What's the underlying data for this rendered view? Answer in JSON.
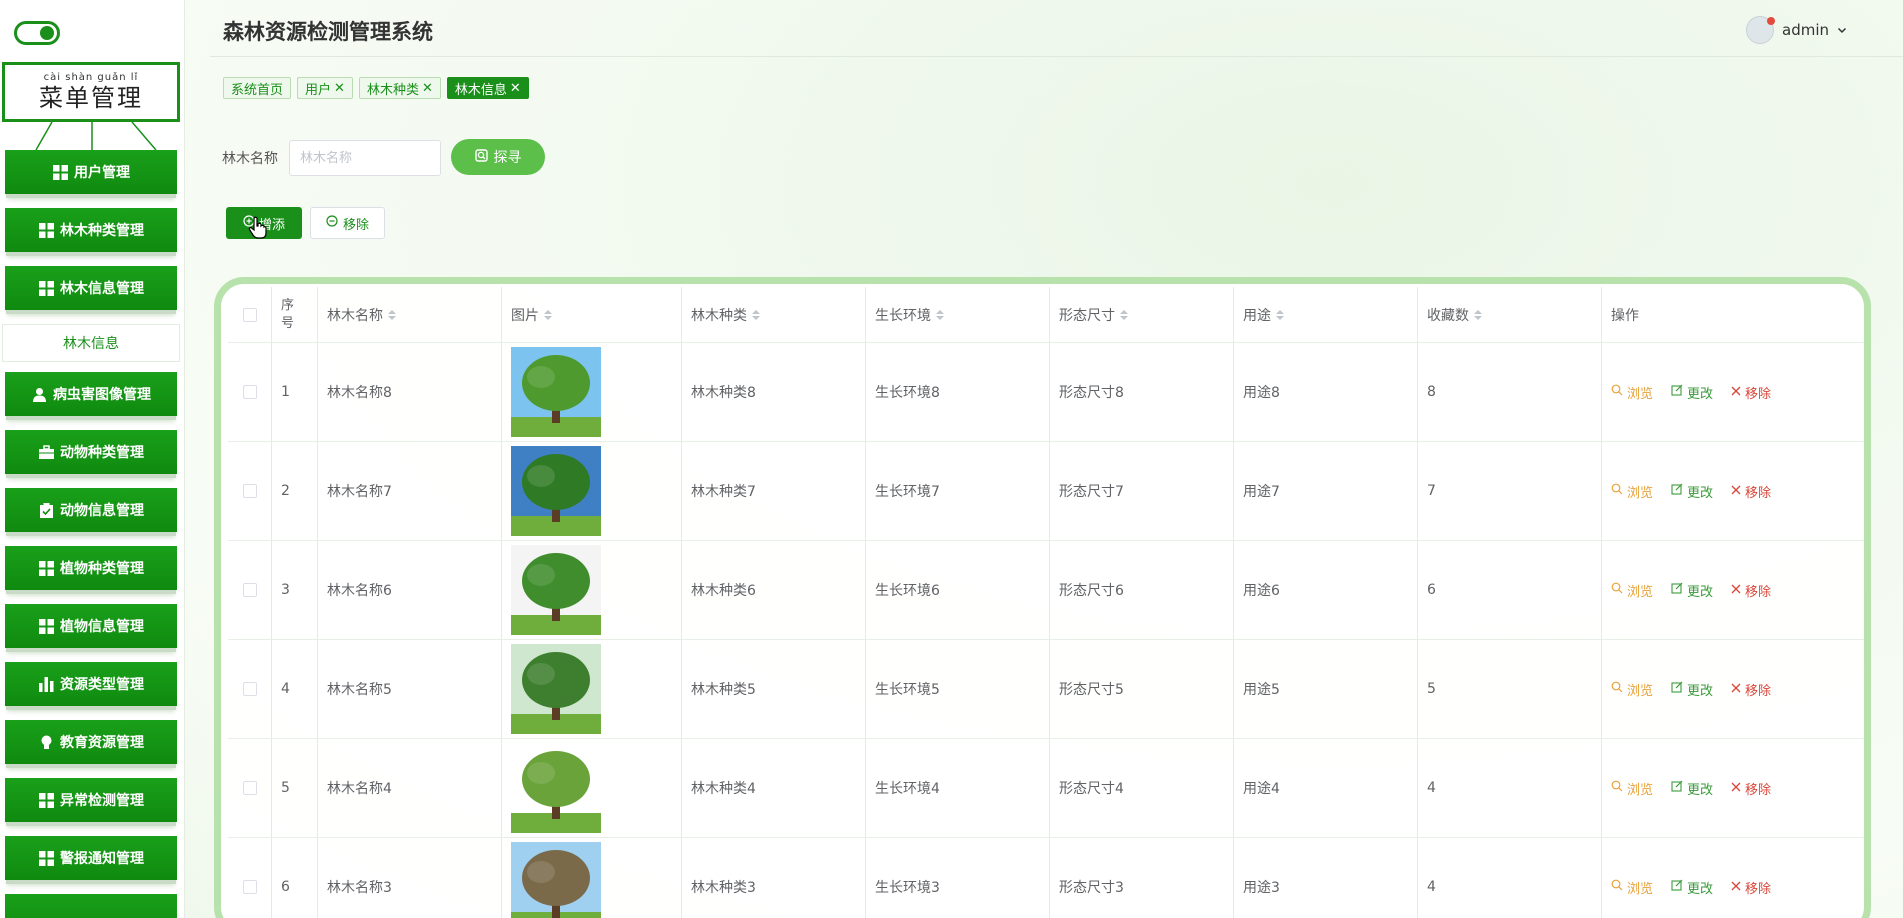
{
  "app": {
    "title": "森林资源检测管理系统"
  },
  "user": {
    "name": "admin"
  },
  "sidebar": {
    "title_pinyin": "cài shàn guǎn lǐ",
    "title": "菜单管理",
    "items": [
      {
        "label": "用户管理",
        "icon": "grid-icon"
      },
      {
        "label": "林木种类管理",
        "icon": "grid-icon"
      },
      {
        "label": "林木信息管理",
        "icon": "grid-icon"
      },
      {
        "label": "病虫害图像管理",
        "icon": "user-icon"
      },
      {
        "label": "动物种类管理",
        "icon": "briefcase-icon"
      },
      {
        "label": "动物信息管理",
        "icon": "clipboard-icon"
      },
      {
        "label": "植物种类管理",
        "icon": "grid-icon"
      },
      {
        "label": "植物信息管理",
        "icon": "grid-icon"
      },
      {
        "label": "资源类型管理",
        "icon": "bar-chart-icon"
      },
      {
        "label": "教育资源管理",
        "icon": "lightbulb-icon"
      },
      {
        "label": "异常检测管理",
        "icon": "grid-icon"
      },
      {
        "label": "警报通知管理",
        "icon": "grid-icon"
      }
    ],
    "sub_item": "林木信息"
  },
  "tabs": [
    {
      "label": "系统首页",
      "closable": false
    },
    {
      "label": "用户",
      "closable": true
    },
    {
      "label": "林木种类",
      "closable": true
    },
    {
      "label": "林木信息",
      "closable": true,
      "active": true
    }
  ],
  "search": {
    "label": "林木名称",
    "placeholder": "林木名称",
    "button": "探寻"
  },
  "actions": {
    "add": "增添",
    "remove": "移除"
  },
  "table": {
    "headers": {
      "index_line1": "序",
      "index_line2": "号",
      "name": "林木名称",
      "image": "图片",
      "kind": "林木种类",
      "env": "生长环境",
      "size": "形态尺寸",
      "use": "用途",
      "fav": "收藏数",
      "ops": "操作"
    },
    "op_labels": {
      "view": "浏览",
      "edit": "更改",
      "delete": "移除"
    },
    "rows": [
      {
        "index": "1",
        "name": "林木名称8",
        "kind": "林木种类8",
        "env": "生长环境8",
        "size": "形态尺寸8",
        "use": "用途8",
        "fav": "8"
      },
      {
        "index": "2",
        "name": "林木名称7",
        "kind": "林木种类7",
        "env": "生长环境7",
        "size": "形态尺寸7",
        "use": "用途7",
        "fav": "7"
      },
      {
        "index": "3",
        "name": "林木名称6",
        "kind": "林木种类6",
        "env": "生长环境6",
        "size": "形态尺寸6",
        "use": "用途6",
        "fav": "6"
      },
      {
        "index": "4",
        "name": "林木名称5",
        "kind": "林木种类5",
        "env": "生长环境5",
        "size": "形态尺寸5",
        "use": "用途5",
        "fav": "5"
      },
      {
        "index": "5",
        "name": "林木名称4",
        "kind": "林木种类4",
        "env": "生长环境4",
        "size": "形态尺寸4",
        "use": "用途4",
        "fav": "4"
      },
      {
        "index": "6",
        "name": "林木名称3",
        "kind": "林木种类3",
        "env": "生长环境3",
        "size": "形态尺寸3",
        "use": "用途3",
        "fav": "4"
      }
    ]
  },
  "colors": {
    "brand": "#1a8f1a",
    "accent": "#5cbf4a",
    "view": "#e8a23a",
    "delete": "#d9473a"
  }
}
